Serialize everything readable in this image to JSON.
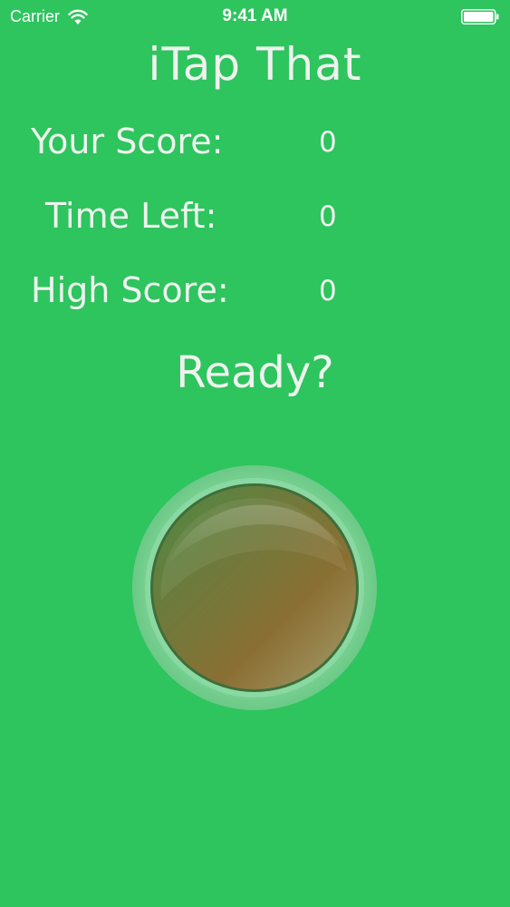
{
  "status_bar": {
    "carrier": "Carrier",
    "time": "9:41 AM"
  },
  "app": {
    "title": "iTap That"
  },
  "stats": {
    "score_label": "Your Score:",
    "score_value": "0",
    "time_label": "Time Left:",
    "time_value": "0",
    "high_label": "High Score:",
    "high_value": "0"
  },
  "prompt": {
    "ready": "Ready?"
  },
  "colors": {
    "background": "#2ec45e",
    "button_ring": "#8fd9a3",
    "button_face": "#7a6a35"
  },
  "icons": {
    "wifi": "wifi-icon",
    "battery": "battery-icon",
    "tap_button": "round-tap-button"
  }
}
